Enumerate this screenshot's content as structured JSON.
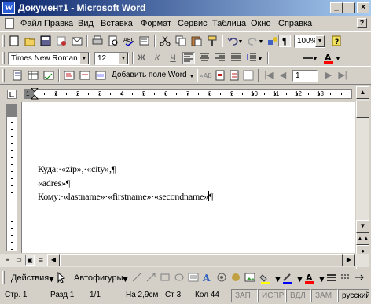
{
  "window": {
    "title": "Документ1 - Microsoft Word",
    "app_icon": "W",
    "min_symbol": "_",
    "max_symbol": "□",
    "close_symbol": "×"
  },
  "menu": {
    "items": [
      "Файл",
      "Правка",
      "Вид",
      "Вставка",
      "Формат",
      "Сервис",
      "Таблица",
      "Окно",
      "Справка"
    ],
    "help_symbol": "?"
  },
  "standard_toolbar": {
    "zoom": "100%",
    "pilcrow": "¶"
  },
  "formatting_toolbar": {
    "font": "Times New Roman",
    "size": "12",
    "bold": "Ж",
    "italic": "К",
    "underline": "Ч"
  },
  "mailmerge_toolbar": {
    "insert_field_label": "Добавить поле Word",
    "record_number": "1"
  },
  "ruler": {
    "numbers": [
      "1",
      "1",
      "2",
      "3",
      "4",
      "5",
      "6",
      "7",
      "8",
      "9",
      "10",
      "11",
      "12",
      "13"
    ]
  },
  "document": {
    "lines": [
      "Куда:·«zip»,·«city»,¶",
      "«adres»¶",
      "Кому:·«lastname»·«firstname»·«secondname»"
    ],
    "end_mark": "¶"
  },
  "draw_toolbar": {
    "actions_label": "Действия",
    "autoshapes_label": "Автофигуры"
  },
  "status": {
    "page": "Стр. 1",
    "section": "Разд 1",
    "pages": "1/1",
    "position": "На 2,9см",
    "line": "Ст 3",
    "column": "Кол 44",
    "rec": "ЗАП",
    "trk": "ИСПР",
    "ext": "ВДЛ",
    "ovr": "ЗАМ",
    "lang": "русский"
  }
}
